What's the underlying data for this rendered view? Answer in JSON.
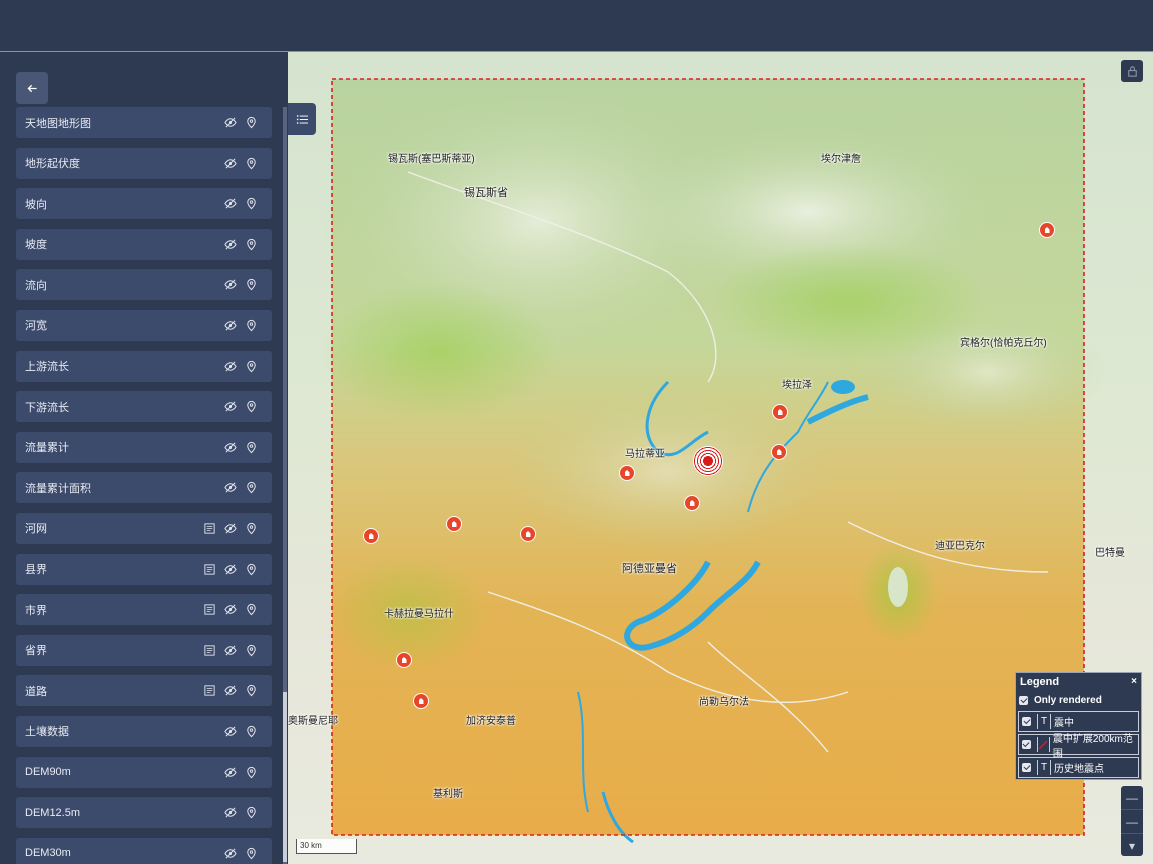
{
  "sidebar": {
    "items": [
      {
        "label": "天地图地形图",
        "has_table": false
      },
      {
        "label": "地形起伏度",
        "has_table": false
      },
      {
        "label": "坡向",
        "has_table": false
      },
      {
        "label": "坡度",
        "has_table": false
      },
      {
        "label": "流向",
        "has_table": false
      },
      {
        "label": "河宽",
        "has_table": false
      },
      {
        "label": "上游流长",
        "has_table": false
      },
      {
        "label": "下游流长",
        "has_table": false
      },
      {
        "label": "流量累计",
        "has_table": false
      },
      {
        "label": "流量累计面积",
        "has_table": false
      },
      {
        "label": "河网",
        "has_table": true
      },
      {
        "label": "县界",
        "has_table": true
      },
      {
        "label": "市界",
        "has_table": true
      },
      {
        "label": "省界",
        "has_table": true
      },
      {
        "label": "道路",
        "has_table": true
      },
      {
        "label": "土壤数据",
        "has_table": false
      },
      {
        "label": "DEM90m",
        "has_table": false
      },
      {
        "label": "DEM12.5m",
        "has_table": false
      },
      {
        "label": "DEM30m",
        "has_table": false
      }
    ]
  },
  "map": {
    "places": [
      {
        "name": "锡瓦斯(塞巴斯蒂亚)"
      },
      {
        "name": "锡瓦斯省"
      },
      {
        "name": "埃尔津詹"
      },
      {
        "name": "宾格尔(恰帕克丘尔)"
      },
      {
        "name": "埃拉泽"
      },
      {
        "name": "马拉蒂亚"
      },
      {
        "name": "迪亚巴克尔"
      },
      {
        "name": "巴特曼"
      },
      {
        "name": "阿德亚曼省"
      },
      {
        "name": "卡赫拉曼马拉什"
      },
      {
        "name": "尚勒乌尔法"
      },
      {
        "name": "加济安泰普"
      },
      {
        "name": "奥斯曼尼耶"
      },
      {
        "name": "基利斯"
      }
    ],
    "scale_label": "30 km",
    "colors": {
      "epicenter": "#d71a1a",
      "history_marker": "#e6462a",
      "boundary": "#d42222",
      "water": "#2fa8e0"
    }
  },
  "legend": {
    "title": "Legend",
    "close": "×",
    "only_rendered": "Only rendered",
    "entries": [
      {
        "symbol": "T",
        "label": "震中"
      },
      {
        "symbol": "line",
        "label": "震中扩展200km范围"
      },
      {
        "symbol": "T",
        "label": "历史地震点"
      }
    ]
  },
  "icons": [
    "back-arrow-icon",
    "eye-icon",
    "location-pin-icon",
    "table-icon",
    "layer-list-icon",
    "lock-icon"
  ]
}
